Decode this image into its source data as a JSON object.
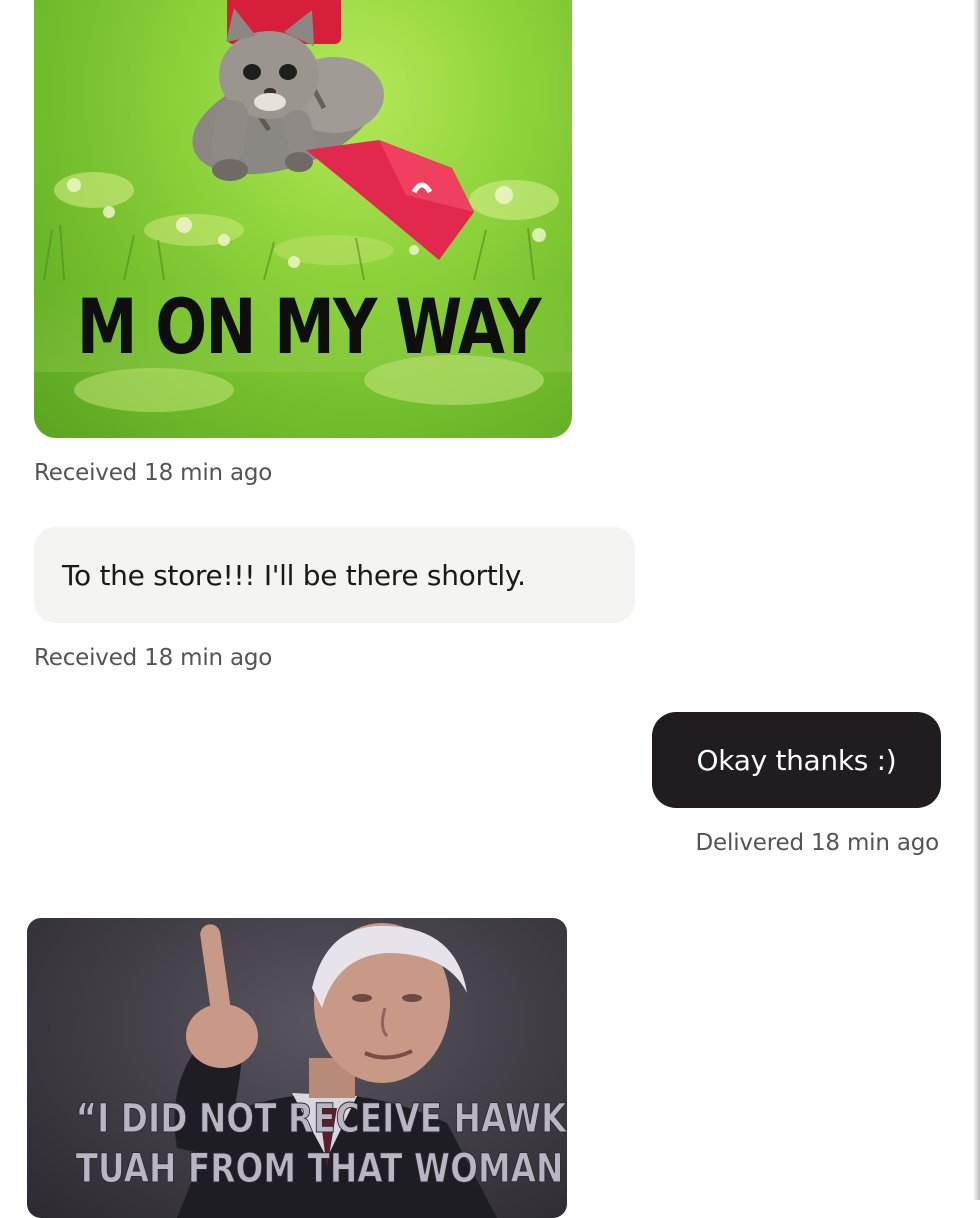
{
  "conversation": {
    "messages": [
      {
        "type": "image",
        "direction": "received",
        "caption": "M ON MY WAY",
        "meta": "Received 18 min ago"
      },
      {
        "type": "text",
        "direction": "received",
        "text": "To the store!!! I'll be there shortly.",
        "meta": "Received 18 min ago"
      },
      {
        "type": "text",
        "direction": "sent",
        "text": "Okay thanks :)",
        "meta": "Delivered 18 min ago"
      },
      {
        "type": "image",
        "direction": "received",
        "caption_lines": [
          "“I DID NOT RECEIVE HAWK",
          "TUAH FROM THAT WOMAN”"
        ]
      }
    ]
  },
  "colors": {
    "sent_bubble": "#211c20",
    "received_bubble": "#f4f4f2",
    "meta_text": "#545454"
  }
}
